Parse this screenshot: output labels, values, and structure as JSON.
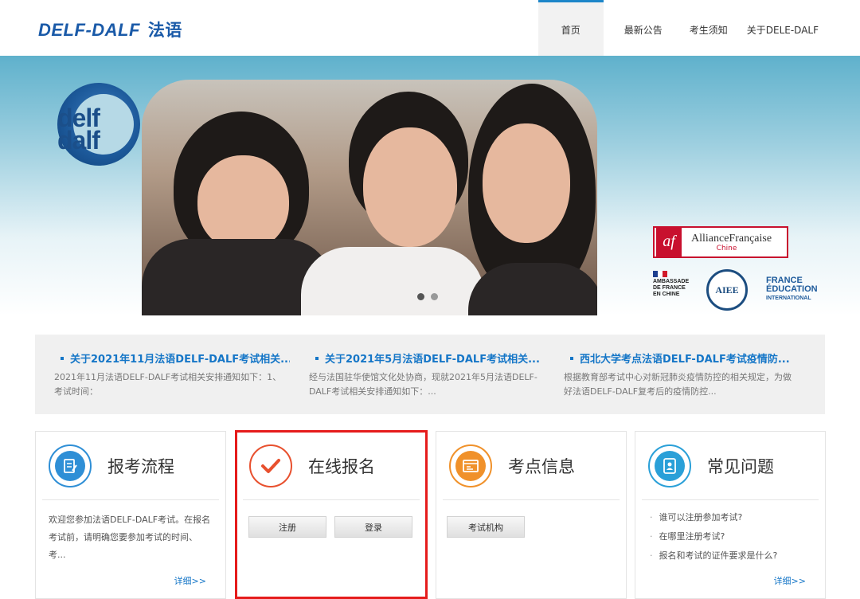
{
  "header": {
    "logo_text": "DELF-DALF",
    "logo_cn": "法语",
    "nav": [
      "首页",
      "最新公告",
      "考生须知",
      "关于DELE-DALF"
    ]
  },
  "banner": {
    "logo_lines": [
      "delf",
      "dalf"
    ],
    "af_logo": "af",
    "af_name": "AllianceFrançaise",
    "af_sub": "Chine",
    "ambassade_lines": [
      "AMBASSADE",
      "DE FRANCE",
      "EN CHINE"
    ],
    "aiee": "AIEE",
    "fei_lines": [
      "FRANCE",
      "ÉDUCATION",
      "INTERNATIONAL"
    ],
    "carousel_dots": 2,
    "carousel_active": 0
  },
  "news": [
    {
      "title": "关于2021年11月法语DELF-DALF考试相关...",
      "desc": "2021年11月法语DELF-DALF考试相关安排通知如下：1、考试时间："
    },
    {
      "title": "关于2021年5月法语DELF-DALF考试相关...",
      "desc": "经与法国驻华使馆文化处协商，现就2021年5月法语DELF-DALF考试相关安排通知如下：..."
    },
    {
      "title": "西北大学考点法语DELF-DALF考试疫情防...",
      "desc": "根据教育部考试中心对新冠肺炎疫情防控的相关规定，为做好法语DELF-DALF复考后的疫情防控..."
    }
  ],
  "cards": {
    "process": {
      "title": "报考流程",
      "text": "欢迎您参加法语DELF-DALF考试。在报名考试前，请明确您要参加考试的时间、考...",
      "more": "详细>>"
    },
    "register": {
      "title": "在线报名",
      "btn_register": "注册",
      "btn_login": "登录"
    },
    "centers": {
      "title": "考点信息",
      "btn_institutions": "考试机构"
    },
    "faq": {
      "title": "常见问题",
      "items": [
        "谁可以注册参加考试?",
        "在哪里注册考试?",
        "报名和考试的证件要求是什么?"
      ],
      "more": "详细>>"
    }
  },
  "colors": {
    "accent": "#1576c7",
    "highlight": "#e51b1b",
    "check": "#e8502e",
    "calendar": "#f0912a"
  }
}
